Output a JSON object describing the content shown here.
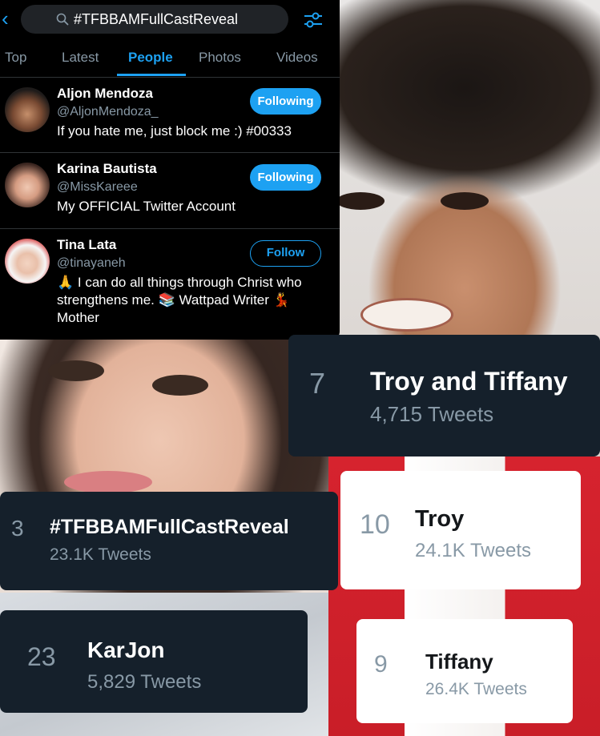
{
  "search": {
    "query": "#TFBBAMFullCastReveal",
    "back_icon": "chevron-left-icon",
    "search_icon": "search-icon",
    "filter_icon": "filter-sliders-icon"
  },
  "tabs": [
    {
      "label": "Top",
      "active": false
    },
    {
      "label": "Latest",
      "active": false
    },
    {
      "label": "People",
      "active": true
    },
    {
      "label": "Photos",
      "active": false
    },
    {
      "label": "Videos",
      "active": false
    }
  ],
  "people": [
    {
      "name": "Aljon Mendoza",
      "handle": "@AljonMendoza_",
      "bio": "If you hate me, just block me :) #00333",
      "button": "Following"
    },
    {
      "name": "Karina Bautista",
      "handle": "@MissKareee",
      "bio": "My OFFICIAL Twitter Account",
      "button": "Following"
    },
    {
      "name": "Tina Lata",
      "handle": "@tinayaneh",
      "bio": "🙏 I can do all things through Christ who strengthens me. 📚 Wattpad Writer 💃 Mother",
      "button": "Follow"
    }
  ],
  "trends": {
    "t7": {
      "rank": "7",
      "name": "Troy and Tiffany",
      "count": "4,715 Tweets"
    },
    "t3": {
      "rank": "3",
      "name": "#TFBBAMFullCastReveal",
      "count": "23.1K Tweets"
    },
    "t10": {
      "rank": "10",
      "name": "Troy",
      "count": "24.1K Tweets"
    },
    "t23": {
      "rank": "23",
      "name": "KarJon",
      "count": "5,829 Tweets"
    },
    "t9": {
      "rank": "9",
      "name": "Tiffany",
      "count": "26.4K Tweets"
    }
  },
  "colors": {
    "accent": "#1da1f2",
    "panel_bg": "#000000",
    "dark_card": "#15202b",
    "muted": "#8899a6"
  }
}
